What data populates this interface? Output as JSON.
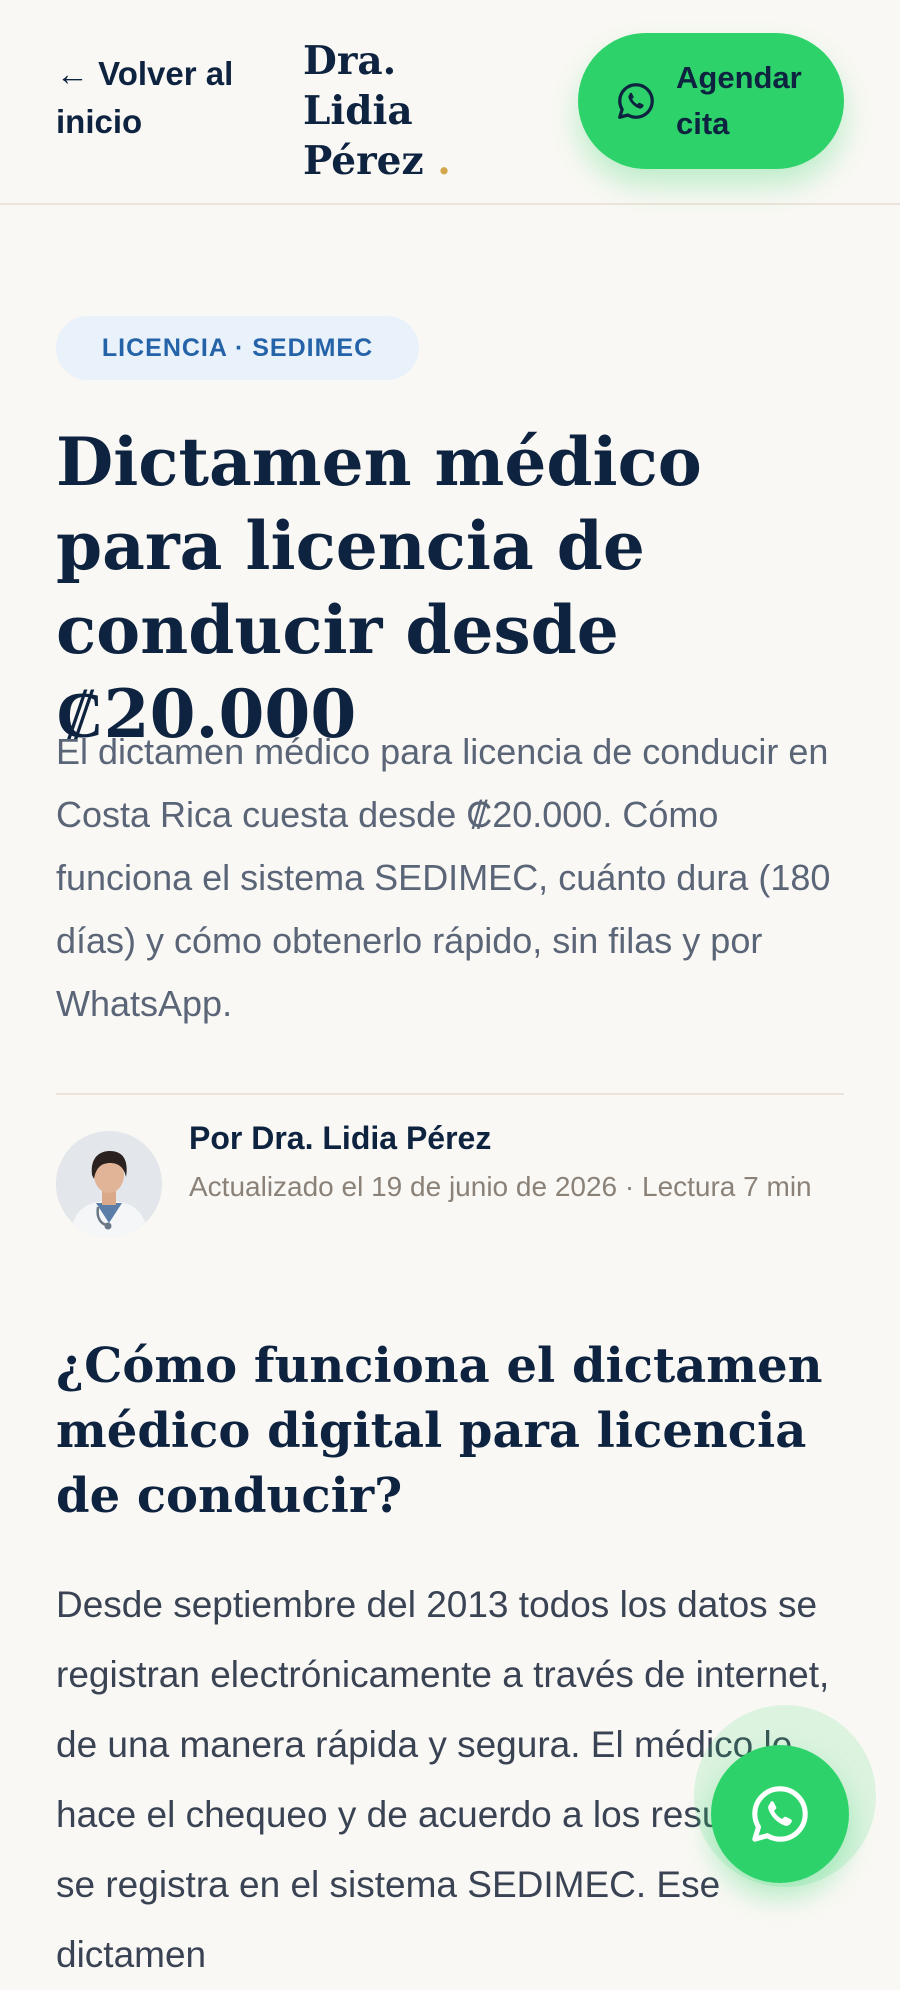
{
  "header": {
    "back_label": "← Volver al inicio",
    "brand_name": "Dra. Lidia Pérez",
    "brand_dot": ".",
    "cta_label": "Agendar cita",
    "cta_icon": "whatsapp-icon"
  },
  "article": {
    "tag": "LICENCIA · SEDIMEC",
    "title": "Dictamen médico para licencia de conducir desde ₡20.000",
    "lead": "El dictamen médico para licencia de conducir en Costa Rica cuesta desde ₡20.000. Cómo funciona el sistema SEDIMEC, cuánto dura (180 días) y cómo obtenerlo rápido, sin filas y por WhatsApp.",
    "author": {
      "name": "Por Dra. Lidia Pérez",
      "meta": "Actualizado el 19 de junio de 2026 · Lectura 7 min"
    },
    "section_heading": "¿Cómo funciona el dictamen médico digital para licencia de conducir?",
    "section_body": "Desde septiembre del 2013 todos los datos se registran electrónicamente a través de internet, de una manera rápida y segura. El médico le hace el chequeo y de acuerdo a los resultados, se registra en el sistema SEDIMEC. Ese dictamen"
  },
  "floating": {
    "icon": "whatsapp-icon"
  },
  "colors": {
    "accent_green": "#2dd36a",
    "navy": "#0e2340",
    "tag_blue": "#2563a8",
    "background": "#faf8f4",
    "brand_dot": "#d3a64d"
  }
}
